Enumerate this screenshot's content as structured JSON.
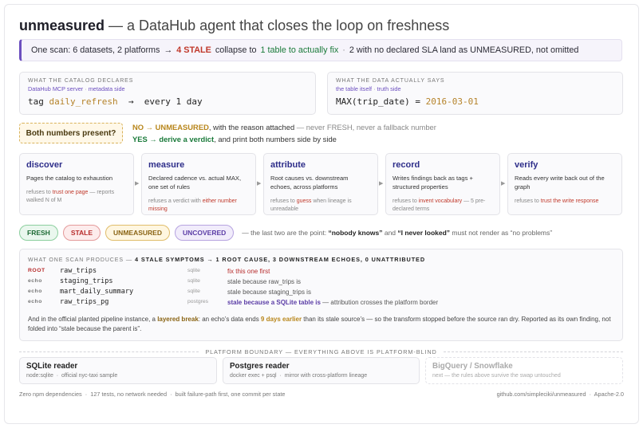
{
  "title": {
    "brand": "unmeasured",
    "rest": " — a DataHub agent that closes the loop on freshness"
  },
  "summary": {
    "part1": "One scan: 6 datasets, 2 platforms",
    "arrow": "→",
    "stale": "4 STALE",
    "part2": "collapse to",
    "fix": "1 table to actually fix",
    "dot": "·",
    "part3": "2 with no declared SLA land as UNMEASURED, not omitted"
  },
  "declares": {
    "heading": "What the catalog declares",
    "source": "DataHub MCP server",
    "dot": "·",
    "side": "metadata side",
    "tag": "tag",
    "tag_value": "daily_refresh",
    "arrow": "→",
    "cadence": "every 1 day"
  },
  "says": {
    "heading": "What the data actually says",
    "source": "the table itself",
    "dot": "·",
    "side": "truth side",
    "expr": "MAX(trip_date) =",
    "value": "2016-03-01"
  },
  "question": {
    "label": "Both numbers present?",
    "no_label": "NO → UNMEASURED",
    "no_text": ", with the reason attached",
    "no_muted": " — never FRESH, never a fallback number",
    "yes_label": "YES → derive a verdict",
    "yes_text": ", and print both numbers side by side"
  },
  "steps": [
    {
      "name": "discover",
      "desc": "Pages the catalog to exhaustion",
      "refuse_pre": "refuses to ",
      "refuse_em": "trust one page",
      "refuse_post": " — reports walked N of M"
    },
    {
      "name": "measure",
      "desc": "Declared cadence vs. actual MAX, one set of rules",
      "refuse_pre": "refuses a verdict with ",
      "refuse_em": "either number missing",
      "refuse_post": ""
    },
    {
      "name": "attribute",
      "desc": "Root causes vs. downstream echoes, across platforms",
      "refuse_pre": "refuses to ",
      "refuse_em": "guess",
      "refuse_post": " when lineage is unreadable"
    },
    {
      "name": "record",
      "desc": "Writes findings back as tags + structured properties",
      "refuse_pre": "refuses to ",
      "refuse_em": "invent vocabulary",
      "refuse_post": " — 5 pre-declared terms"
    },
    {
      "name": "verify",
      "desc": "Reads every write back out of the graph",
      "refuse_pre": "refuses to ",
      "refuse_em": "trust the write response",
      "refuse_post": ""
    }
  ],
  "step_arrow": "▶",
  "verdicts": {
    "labels": [
      "FRESH",
      "STALE",
      "UNMEASURED",
      "UNCOVERED"
    ],
    "note_pre": "— the last two are the point: ",
    "note_q1": "“nobody knows”",
    "note_mid": " and ",
    "note_q2": "“I never looked”",
    "note_post": " must not render as “no problems”"
  },
  "scan": {
    "heading": "What one scan produces",
    "sep": " — ",
    "summary": "4 STALE SYMPTOMS → 1 ROOT CAUSE, 3 DOWNSTREAM ECHOES, 0 UNATTRIBUTED",
    "rows": [
      {
        "kind": "ROOT",
        "name": "raw_trips",
        "platform": "sqlite",
        "msg": "fix this one first",
        "msg_em": "",
        "msg_post": ""
      },
      {
        "kind": "echo",
        "name": "staging_trips",
        "platform": "sqlite",
        "msg": "stale because raw_trips is",
        "msg_em": "",
        "msg_post": ""
      },
      {
        "kind": "echo",
        "name": "mart_daily_summary",
        "platform": "sqlite",
        "msg": "stale because staging_trips is",
        "msg_em": "",
        "msg_post": ""
      },
      {
        "kind": "echo",
        "name": "raw_trips_pg",
        "platform": "postgres",
        "msg": "",
        "msg_em": "stale because a SQLite table is",
        "msg_post": " — attribution crosses the platform border"
      }
    ],
    "foot_pre": "And in the official planted pipeline instance, a ",
    "foot_b1": "layered break",
    "foot_mid": ": an echo’s data ends ",
    "foot_b2": "9 days earlier",
    "foot_post": " than its stale source’s — so the transform stopped before the source ran dry. Reported as its own finding, not folded into “stale because the parent is”."
  },
  "boundary": "Platform boundary — everything above is platform-blind",
  "readers": [
    {
      "name": "SQLite reader",
      "d1": "node:sqlite",
      "dot": "·",
      "d2": "official nyc-taxi sample",
      "future": false
    },
    {
      "name": "Postgres reader",
      "d1": "docker exec + psql",
      "dot": "·",
      "d2": "mirror with cross-platform lineage",
      "future": false
    },
    {
      "name": "BigQuery / Snowflake",
      "d1": "next — the rules above survive the swap untouched",
      "dot": "",
      "d2": "",
      "future": true
    }
  ],
  "footer": {
    "f1": "Zero npm dependencies",
    "f2": "127 tests, no network needed",
    "f3": "built failure-path first, one commit per state",
    "dot": "·",
    "repo": "github.com/simpleciki/unmeasured",
    "license": "Apache-2.0"
  },
  "colors": {
    "accent": "#6c4fbf",
    "stale": "#c0392b",
    "fix": "#1a7a3a",
    "unmeasured": "#b8861b"
  }
}
